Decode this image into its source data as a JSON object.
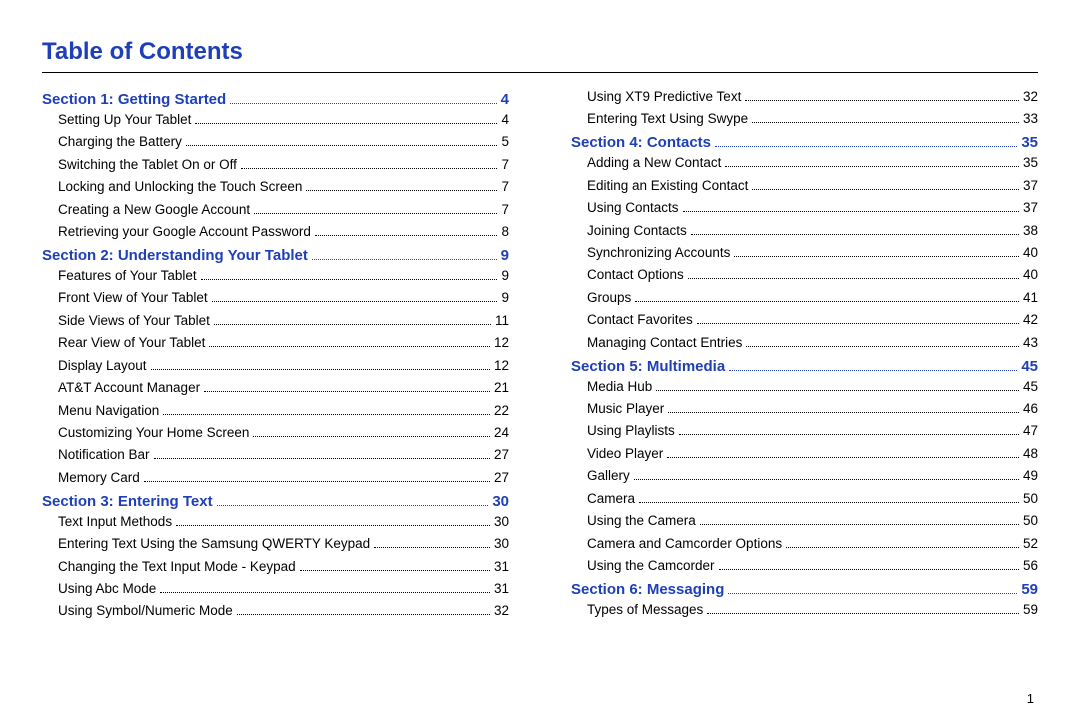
{
  "title": "Table of Contents",
  "page_number": "1",
  "sections": [
    {
      "heading": "Section 1:  Getting Started",
      "page": "4",
      "entries": [
        {
          "label": "Setting Up Your Tablet",
          "page": "4"
        },
        {
          "label": "Charging the Battery",
          "page": "5"
        },
        {
          "label": "Switching the Tablet On or Off",
          "page": "7"
        },
        {
          "label": "Locking and Unlocking the Touch Screen",
          "page": "7"
        },
        {
          "label": "Creating a New Google Account",
          "page": "7"
        },
        {
          "label": "Retrieving your Google Account Password",
          "page": "8"
        }
      ]
    },
    {
      "heading": "Section 2:  Understanding Your Tablet",
      "page": "9",
      "entries": [
        {
          "label": "Features of Your Tablet",
          "page": "9"
        },
        {
          "label": "Front View of Your Tablet",
          "page": "9"
        },
        {
          "label": "Side Views of Your Tablet",
          "page": "11"
        },
        {
          "label": "Rear View of Your Tablet",
          "page": "12"
        },
        {
          "label": "Display Layout",
          "page": "12"
        },
        {
          "label": "AT&T Account Manager",
          "page": "21"
        },
        {
          "label": "Menu Navigation",
          "page": "22"
        },
        {
          "label": "Customizing Your Home Screen",
          "page": "24"
        },
        {
          "label": "Notification Bar",
          "page": "27"
        },
        {
          "label": "Memory Card",
          "page": "27"
        }
      ]
    },
    {
      "heading": "Section 3:  Entering Text",
      "page": "30",
      "entries": [
        {
          "label": "Text Input Methods",
          "page": "30"
        },
        {
          "label": "Entering Text Using the Samsung QWERTY Keypad",
          "page": "30"
        },
        {
          "label": "Changing the Text Input Mode - Keypad",
          "page": "31"
        },
        {
          "label": "Using Abc Mode",
          "page": "31"
        },
        {
          "label": "Using Symbol/Numeric Mode",
          "page": "32"
        },
        {
          "label": "Using XT9 Predictive Text",
          "page": "32"
        },
        {
          "label": "Entering Text Using Swype",
          "page": "33"
        }
      ]
    },
    {
      "heading": "Section 4:  Contacts",
      "page": "35",
      "entries": [
        {
          "label": "Adding a New Contact",
          "page": "35"
        },
        {
          "label": "Editing an Existing Contact",
          "page": "37"
        },
        {
          "label": "Using Contacts",
          "page": "37"
        },
        {
          "label": "Joining Contacts",
          "page": "38"
        },
        {
          "label": "Synchronizing Accounts",
          "page": "40"
        },
        {
          "label": "Contact Options",
          "page": "40"
        },
        {
          "label": "Groups",
          "page": "41"
        },
        {
          "label": "Contact Favorites",
          "page": "42"
        },
        {
          "label": "Managing Contact Entries",
          "page": "43"
        }
      ]
    },
    {
      "heading": "Section 5:  Multimedia",
      "page": "45",
      "entries": [
        {
          "label": "Media Hub",
          "page": "45"
        },
        {
          "label": "Music Player",
          "page": "46"
        },
        {
          "label": "Using Playlists",
          "page": "47"
        },
        {
          "label": "Video Player",
          "page": "48"
        },
        {
          "label": "Gallery",
          "page": "49"
        },
        {
          "label": "Camera",
          "page": "50"
        },
        {
          "label": "Using the Camera",
          "page": "50"
        },
        {
          "label": "Camera and Camcorder Options",
          "page": "52"
        },
        {
          "label": "Using the Camcorder",
          "page": "56"
        }
      ]
    },
    {
      "heading": "Section 6:  Messaging",
      "page": "59",
      "entries": [
        {
          "label": "Types of Messages",
          "page": "59"
        }
      ]
    }
  ]
}
